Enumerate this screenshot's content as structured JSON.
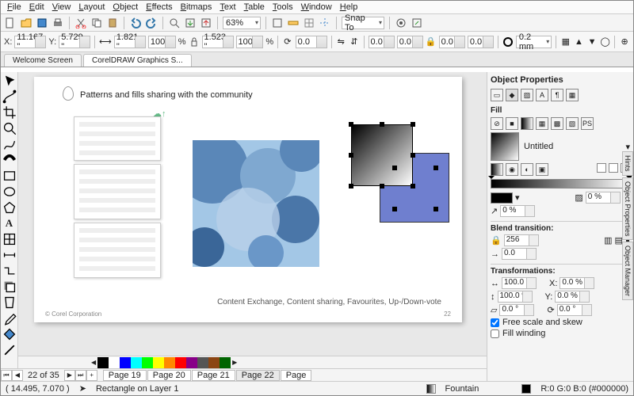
{
  "menu": {
    "items": [
      "File",
      "Edit",
      "View",
      "Layout",
      "Object",
      "Effects",
      "Bitmaps",
      "Text",
      "Table",
      "Tools",
      "Window",
      "Help"
    ]
  },
  "toolbar1": {
    "zoom": "63%",
    "snap": "Snap To"
  },
  "propbar": {
    "x": "11.167 \"",
    "y": "5.729 \"",
    "w": "1.821 \"",
    "h": "1.523 \"",
    "sx": "100.0",
    "sy": "100.0",
    "rot": "0.0",
    "angle1": "0.0 °",
    "angle2": "0.0 °",
    "angle3": "0.0 °",
    "angle4": "0.0 °",
    "outline": "0.2 mm"
  },
  "tabs": {
    "welcome": "Welcome Screen",
    "doc": "CorelDRAW Graphics S..."
  },
  "slide": {
    "title": "Patterns and fills sharing with the community",
    "caption": "Content Exchange, Content sharing, Favourites, Up-/Down-vote",
    "copyright": "© Corel Corporation",
    "page": "22"
  },
  "pagenav": {
    "count": "22 of 35",
    "pages": [
      "Page 19",
      "Page 20",
      "Page 21",
      "Page 22",
      "Page"
    ]
  },
  "status": {
    "coords": "( 14.495, 7.070 )",
    "obj": "Rectangle on Layer 1",
    "fill": "Fountain",
    "rgb": "R:0 G:0 B:0 (#000000)"
  },
  "panel": {
    "title": "Object Properties",
    "fill": "Fill",
    "untitled": "Untitled",
    "pct0": "0 %",
    "steps": "256",
    "zero": "0.0",
    "blend": "Blend transition:",
    "trans": "Transformations:",
    "w": "100.0 %",
    "h": "100.0 %",
    "x": "0.0 %",
    "y": "0.0 %",
    "skew": "0.0 °",
    "rot": "0.0 °",
    "free": "Free scale and skew",
    "wind": "Fill winding"
  },
  "sidetabs": [
    "Hints",
    "Object Properties",
    "Object Manager"
  ],
  "palette": [
    "#000",
    "#fff",
    "#00f",
    "#0ff",
    "#0f0",
    "#ff0",
    "#f80",
    "#f00",
    "#808",
    "#555",
    "#8b4513",
    "#006400"
  ],
  "colorbar": [
    "#000",
    "#444",
    "#888",
    "#ccc",
    "#fff",
    "#800",
    "#f00",
    "#f80",
    "#ff0",
    "#8f0",
    "#0f0",
    "#0f8",
    "#0ff",
    "#08f",
    "#00f",
    "#80f",
    "#f0f",
    "#f08"
  ]
}
